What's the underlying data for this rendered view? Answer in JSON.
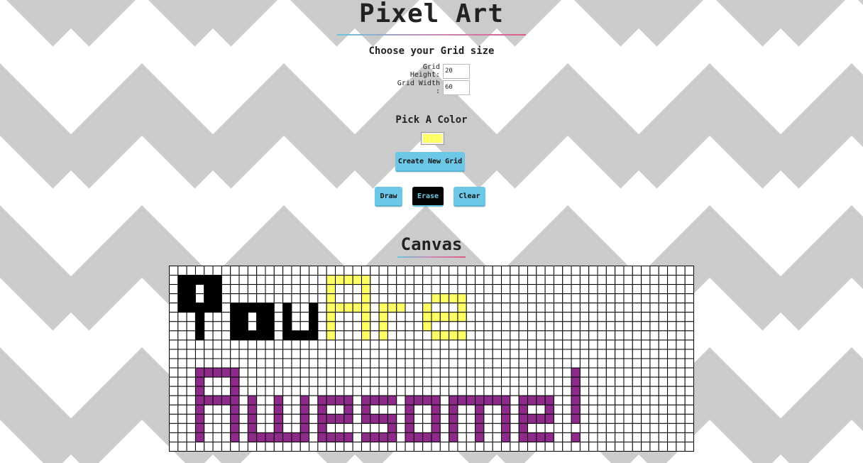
{
  "page": {
    "title": "Pixel Art"
  },
  "grid_size": {
    "heading": "Choose your Grid size",
    "height_label": "Grid Height:",
    "height_value": "20",
    "width_label": "Grid Width :",
    "width_value": "60"
  },
  "color_picker": {
    "heading": "Pick A Color",
    "value": "#ffff66"
  },
  "buttons": {
    "create": "Create New Grid",
    "draw": "Draw",
    "erase": "Erase",
    "clear": "Clear"
  },
  "canvas": {
    "heading": "Canvas",
    "rows": 20,
    "cols": 60,
    "grid_line_color": "#000000",
    "empty_color": "#ffffff",
    "painted": [
      {
        "color": "#000000",
        "cells": [
          [
            1,
            1
          ],
          [
            1,
            2
          ],
          [
            1,
            3
          ],
          [
            1,
            4
          ],
          [
            1,
            5
          ],
          [
            2,
            1
          ],
          [
            2,
            2
          ],
          [
            2,
            4
          ],
          [
            2,
            5
          ],
          [
            3,
            1
          ],
          [
            3,
            2
          ],
          [
            3,
            4
          ],
          [
            3,
            5
          ],
          [
            4,
            1
          ],
          [
            4,
            2
          ],
          [
            4,
            3
          ],
          [
            4,
            4
          ],
          [
            4,
            5
          ],
          [
            5,
            3
          ],
          [
            6,
            3
          ],
          [
            7,
            3
          ],
          [
            4,
            7
          ],
          [
            4,
            8
          ],
          [
            4,
            9
          ],
          [
            4,
            10
          ],
          [
            4,
            11
          ],
          [
            5,
            7
          ],
          [
            5,
            8
          ],
          [
            5,
            10
          ],
          [
            5,
            11
          ],
          [
            6,
            7
          ],
          [
            6,
            8
          ],
          [
            6,
            10
          ],
          [
            6,
            11
          ],
          [
            7,
            7
          ],
          [
            7,
            8
          ],
          [
            7,
            9
          ],
          [
            7,
            10
          ],
          [
            7,
            11
          ],
          [
            4,
            13
          ],
          [
            4,
            16
          ],
          [
            5,
            13
          ],
          [
            5,
            16
          ],
          [
            6,
            13
          ],
          [
            6,
            16
          ],
          [
            7,
            13
          ],
          [
            7,
            14
          ],
          [
            7,
            15
          ],
          [
            7,
            16
          ]
        ]
      },
      {
        "color": "#ffff66",
        "cells": [
          [
            1,
            18
          ],
          [
            1,
            19
          ],
          [
            1,
            20
          ],
          [
            1,
            21
          ],
          [
            1,
            22
          ],
          [
            2,
            18
          ],
          [
            2,
            22
          ],
          [
            3,
            18
          ],
          [
            3,
            22
          ],
          [
            4,
            18
          ],
          [
            4,
            19
          ],
          [
            4,
            20
          ],
          [
            4,
            21
          ],
          [
            4,
            22
          ],
          [
            5,
            18
          ],
          [
            5,
            22
          ],
          [
            6,
            18
          ],
          [
            6,
            22
          ],
          [
            7,
            18
          ],
          [
            7,
            22
          ],
          [
            4,
            24
          ],
          [
            4,
            25
          ],
          [
            4,
            26
          ],
          [
            5,
            24
          ],
          [
            6,
            24
          ],
          [
            7,
            24
          ],
          [
            3,
            30
          ],
          [
            3,
            31
          ],
          [
            3,
            32
          ],
          [
            3,
            33
          ],
          [
            4,
            29
          ],
          [
            4,
            33
          ],
          [
            5,
            29
          ],
          [
            5,
            30
          ],
          [
            5,
            31
          ],
          [
            5,
            32
          ],
          [
            5,
            33
          ],
          [
            6,
            29
          ],
          [
            7,
            30
          ],
          [
            7,
            31
          ],
          [
            7,
            32
          ],
          [
            7,
            33
          ]
        ]
      },
      {
        "color": "#8e2a8a",
        "cells": [
          [
            11,
            3
          ],
          [
            11,
            4
          ],
          [
            11,
            5
          ],
          [
            11,
            6
          ],
          [
            11,
            7
          ],
          [
            12,
            3
          ],
          [
            12,
            7
          ],
          [
            13,
            3
          ],
          [
            13,
            7
          ],
          [
            14,
            3
          ],
          [
            14,
            4
          ],
          [
            14,
            5
          ],
          [
            14,
            6
          ],
          [
            14,
            7
          ],
          [
            15,
            3
          ],
          [
            15,
            7
          ],
          [
            16,
            3
          ],
          [
            16,
            7
          ],
          [
            17,
            3
          ],
          [
            17,
            7
          ],
          [
            18,
            3
          ],
          [
            18,
            7
          ],
          [
            14,
            9
          ],
          [
            14,
            12
          ],
          [
            14,
            15
          ],
          [
            15,
            9
          ],
          [
            15,
            12
          ],
          [
            15,
            15
          ],
          [
            16,
            9
          ],
          [
            16,
            12
          ],
          [
            16,
            15
          ],
          [
            17,
            9
          ],
          [
            17,
            12
          ],
          [
            17,
            15
          ],
          [
            18,
            9
          ],
          [
            18,
            10
          ],
          [
            18,
            11
          ],
          [
            18,
            12
          ],
          [
            18,
            13
          ],
          [
            18,
            14
          ],
          [
            18,
            15
          ],
          [
            14,
            17
          ],
          [
            14,
            18
          ],
          [
            14,
            19
          ],
          [
            14,
            20
          ],
          [
            15,
            17
          ],
          [
            15,
            20
          ],
          [
            16,
            17
          ],
          [
            16,
            18
          ],
          [
            16,
            19
          ],
          [
            16,
            20
          ],
          [
            17,
            17
          ],
          [
            18,
            17
          ],
          [
            18,
            18
          ],
          [
            18,
            19
          ],
          [
            18,
            20
          ],
          [
            14,
            22
          ],
          [
            14,
            23
          ],
          [
            14,
            24
          ],
          [
            14,
            25
          ],
          [
            15,
            22
          ],
          [
            16,
            22
          ],
          [
            16,
            23
          ],
          [
            16,
            24
          ],
          [
            16,
            25
          ],
          [
            17,
            25
          ],
          [
            18,
            22
          ],
          [
            18,
            23
          ],
          [
            18,
            24
          ],
          [
            18,
            25
          ],
          [
            14,
            27
          ],
          [
            14,
            28
          ],
          [
            14,
            29
          ],
          [
            14,
            30
          ],
          [
            15,
            27
          ],
          [
            15,
            30
          ],
          [
            16,
            27
          ],
          [
            16,
            30
          ],
          [
            17,
            27
          ],
          [
            17,
            30
          ],
          [
            18,
            27
          ],
          [
            18,
            28
          ],
          [
            18,
            29
          ],
          [
            18,
            30
          ],
          [
            14,
            32
          ],
          [
            14,
            33
          ],
          [
            14,
            34
          ],
          [
            14,
            35
          ],
          [
            14,
            36
          ],
          [
            14,
            37
          ],
          [
            14,
            38
          ],
          [
            15,
            32
          ],
          [
            15,
            35
          ],
          [
            15,
            38
          ],
          [
            16,
            32
          ],
          [
            16,
            35
          ],
          [
            16,
            38
          ],
          [
            17,
            32
          ],
          [
            17,
            35
          ],
          [
            17,
            38
          ],
          [
            18,
            32
          ],
          [
            18,
            35
          ],
          [
            18,
            38
          ],
          [
            14,
            40
          ],
          [
            14,
            41
          ],
          [
            14,
            42
          ],
          [
            14,
            43
          ],
          [
            15,
            40
          ],
          [
            15,
            43
          ],
          [
            16,
            40
          ],
          [
            16,
            41
          ],
          [
            16,
            42
          ],
          [
            16,
            43
          ],
          [
            17,
            40
          ],
          [
            18,
            40
          ],
          [
            18,
            41
          ],
          [
            18,
            42
          ],
          [
            18,
            43
          ],
          [
            11,
            46
          ],
          [
            12,
            46
          ],
          [
            13,
            46
          ],
          [
            14,
            46
          ],
          [
            15,
            46
          ],
          [
            16,
            46
          ],
          [
            18,
            46
          ]
        ]
      }
    ]
  }
}
